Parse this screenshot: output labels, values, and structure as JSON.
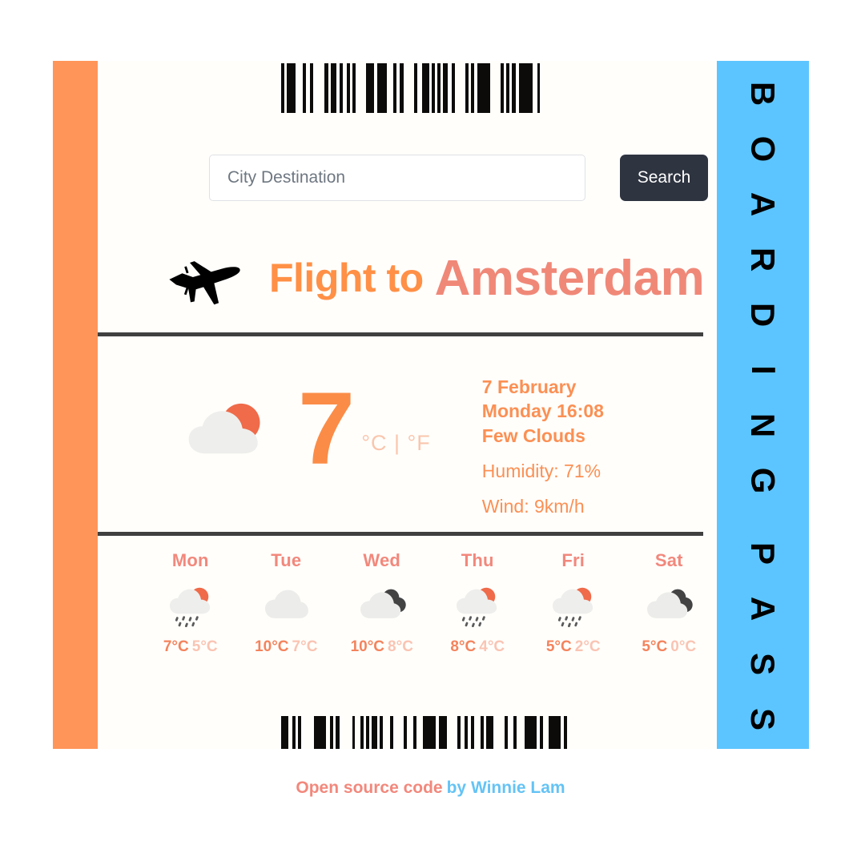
{
  "colors": {
    "stub_left": "#ff9559",
    "stub_right": "#5cc5ff",
    "card_bg": "#fffefb",
    "accent_orange": "#fb8c47",
    "accent_salmon": "#f08878",
    "accent_blue": "#64c3f5",
    "divider": "#404040",
    "button_bg": "#2e3440"
  },
  "stub": {
    "vertical_label": "BOARDING PASS",
    "letters": [
      "B",
      "O",
      "A",
      "R",
      "D",
      "I",
      "N",
      "G",
      "P",
      "A",
      "S",
      "S"
    ]
  },
  "barcodes": {
    "top_name": "barcode-top",
    "bottom_name": "barcode-bottom"
  },
  "search": {
    "placeholder": "City Destination",
    "value": "",
    "button_label": "Search"
  },
  "flight": {
    "prefix": "Flight to",
    "city": "Amsterdam",
    "icon": "airplane-icon"
  },
  "current": {
    "icon": "sun-behind-cloud-icon",
    "temperature": "7",
    "units": "°C | °F",
    "date": "7 February",
    "day_time": "Monday 16:08",
    "condition": "Few Clouds",
    "humidity": "Humidity: 71%",
    "wind": "Wind: 9km/h"
  },
  "forecast": [
    {
      "day": "Mon",
      "icon": "sun-cloud-rain-icon",
      "max": "7°C",
      "min": "5°C"
    },
    {
      "day": "Tue",
      "icon": "cloud-icon",
      "max": "10°C",
      "min": "7°C"
    },
    {
      "day": "Wed",
      "icon": "dark-cloud-icon",
      "max": "10°C",
      "min": "8°C"
    },
    {
      "day": "Thu",
      "icon": "sun-cloud-rain-icon",
      "max": "8°C",
      "min": "4°C"
    },
    {
      "day": "Fri",
      "icon": "sun-cloud-rain-icon",
      "max": "5°C",
      "min": "2°C"
    },
    {
      "day": "Sat",
      "icon": "dark-cloud-icon",
      "max": "5°C",
      "min": "0°C"
    }
  ],
  "footer": {
    "text_primary": "Open source code",
    "text_secondary": "by Winnie Lam"
  }
}
